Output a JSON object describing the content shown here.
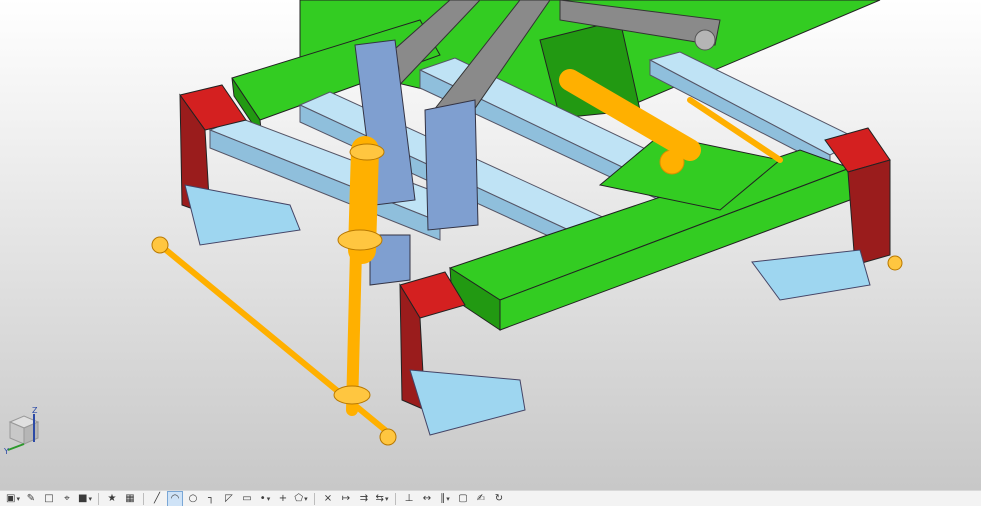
{
  "viewport": {
    "background_top": "#ffffff",
    "background_bottom": "#c8c8c8"
  },
  "colors": {
    "frame_green": "#33cc22",
    "frame_green_dark": "#229912",
    "rail_light_blue": "#bfe3f5",
    "rail_blue_dark": "#8fbfdc",
    "bracket_blue": "#7f9fd0",
    "arm_gray": "#8a8a8a",
    "rod_orange": "#ffb000",
    "rod_orange_dark": "#d98e00",
    "pad_red": "#d42020",
    "pad_darkred": "#9a1c1c",
    "stair_blue": "#9ed6f0"
  },
  "triad": {
    "z_label": "Z",
    "y_label": "Y"
  },
  "toolbar": {
    "items": [
      {
        "icon": "view-cube-icon",
        "caret": true
      },
      {
        "icon": "pencil-icon",
        "caret": false
      },
      {
        "icon": "sketch-plane-icon",
        "caret": false
      },
      {
        "icon": "datum-icon",
        "caret": false
      },
      {
        "icon": "box-icon",
        "caret": true
      },
      {
        "icon": "star-icon",
        "caret": false
      },
      {
        "icon": "grid-icon",
        "caret": false
      },
      {
        "icon": "line-icon",
        "caret": false
      },
      {
        "icon": "arc-icon",
        "caret": false
      },
      {
        "icon": "circle-icon",
        "caret": false
      },
      {
        "icon": "fillet-icon",
        "caret": false
      },
      {
        "icon": "chamfer-icon",
        "caret": false
      },
      {
        "icon": "rectangle-icon",
        "caret": false
      },
      {
        "icon": "point-icon",
        "caret": true
      },
      {
        "icon": "plus-icon",
        "caret": false
      },
      {
        "icon": "polygon-icon",
        "caret": true
      },
      {
        "icon": "trim-icon",
        "caret": false
      },
      {
        "icon": "extend-icon",
        "caret": false
      },
      {
        "icon": "offset-icon",
        "caret": false
      },
      {
        "icon": "mirror-icon",
        "caret": true
      },
      {
        "icon": "constraint-icon",
        "caret": false
      },
      {
        "icon": "dimension-icon",
        "caret": false
      },
      {
        "icon": "parallel-icon",
        "caret": true
      },
      {
        "icon": "square-icon",
        "caret": false
      },
      {
        "icon": "edit-icon",
        "caret": false
      },
      {
        "icon": "refresh-icon",
        "caret": false
      }
    ]
  }
}
